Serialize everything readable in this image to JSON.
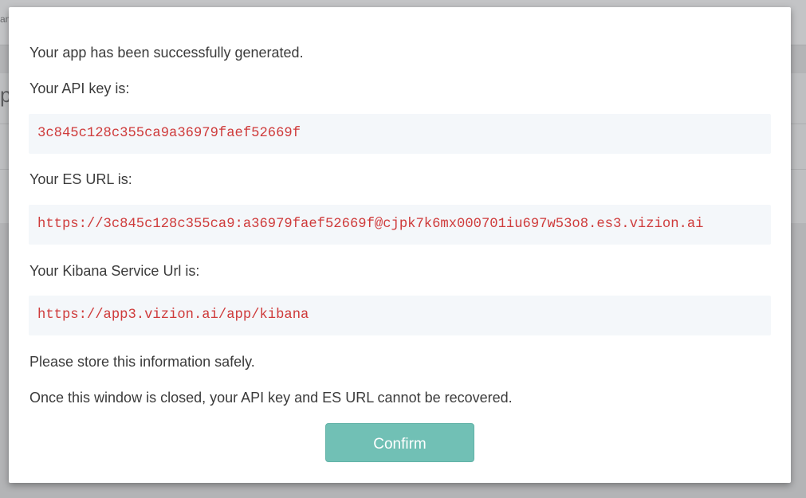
{
  "background": {
    "topbar_fragment": "an",
    "heading_fragment": "p"
  },
  "modal": {
    "success_message": "Your app has been successfully generated.",
    "api_key_label": "Your API key is:",
    "api_key": "3c845c128c355ca9a36979faef52669f",
    "es_url_label": "Your ES URL is:",
    "es_url": "https://3c845c128c355ca9:a36979faef52669f@cjpk7k6mx000701iu697w53o8.es3.vizion.ai",
    "kibana_label": "Your Kibana Service Url is:",
    "kibana_url": "https://app3.vizion.ai/app/kibana",
    "store_notice": "Please store this information safely.",
    "warning_notice": "Once this window is closed, your API key and ES URL cannot be recovered.",
    "confirm_label": "Confirm"
  },
  "colors": {
    "accent": "#71c0b5",
    "code_text": "#cf3b3b",
    "code_bg": "#f4f7fa",
    "overlay": "#b3b4b6"
  }
}
